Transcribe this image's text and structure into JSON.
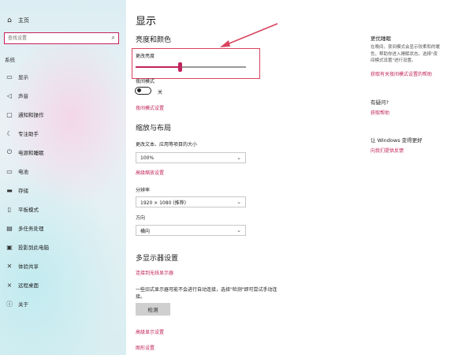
{
  "sidebar": {
    "home": {
      "icon": "home-icon",
      "label": "主页"
    },
    "search": {
      "placeholder": "查找设置",
      "icon": "search-icon"
    },
    "section": "系统",
    "items": [
      {
        "label": "显示",
        "icon": "monitor-icon"
      },
      {
        "label": "声音",
        "icon": "speaker-icon"
      },
      {
        "label": "通知和操作",
        "icon": "notification-icon"
      },
      {
        "label": "专注助手",
        "icon": "moon-icon"
      },
      {
        "label": "电源和睡眠",
        "icon": "power-icon"
      },
      {
        "label": "电池",
        "icon": "battery-icon"
      },
      {
        "label": "存储",
        "icon": "storage-icon"
      },
      {
        "label": "平板模式",
        "icon": "tablet-icon"
      },
      {
        "label": "多任务处理",
        "icon": "multitask-icon"
      },
      {
        "label": "投影到此电脑",
        "icon": "project-icon"
      },
      {
        "label": "体验共享",
        "icon": "share-icon"
      },
      {
        "label": "远程桌面",
        "icon": "remote-icon"
      },
      {
        "label": "关于",
        "icon": "info-icon"
      }
    ]
  },
  "main": {
    "title": "显示",
    "brightness_section": "亮度和颜色",
    "brightness_label": "更改亮度",
    "brightness_value": 0.4,
    "night_light_label": "夜间模式",
    "night_light_state": "关",
    "night_light_link": "夜间模式设置",
    "scale_section": "缩放与布局",
    "scale_label": "更改文本、应用等项目的大小",
    "scale_value": "100%",
    "scale_link": "高级缩放设置",
    "resolution_label": "分辨率",
    "resolution_value": "1920 × 1080 (推荐)",
    "orientation_label": "方向",
    "orientation_value": "横向",
    "multi_section": "多显示器设置",
    "wireless_link": "连接到无线显示器",
    "detect_note_line1": "一些旧式显示器可能不会进行自动连接，选择\"检测\"即可尝试手动连",
    "detect_note_line2": "接。",
    "detect_button": "检测",
    "advanced_link": "高级显示设置",
    "graphics_link": "图形设置"
  },
  "aside": {
    "sleep_title": "更优睡眠",
    "sleep_text_line1": "在晚间，夜间模式会显示较柔和的暖",
    "sleep_text_line2": "色，帮助你进入睡眠状态。选择\"夜",
    "sleep_text_line3": "间模式设置\"进行设置。",
    "sleep_link": "获取有关夜间模式设置的帮助",
    "question_title": "有疑问?",
    "help_link": "获取帮助",
    "improve_title": "让 Windows 变得更好",
    "feedback_link": "向我们提供反馈"
  },
  "colors": {
    "accent": "#c0245c",
    "highlight_box": "#d9435e"
  }
}
